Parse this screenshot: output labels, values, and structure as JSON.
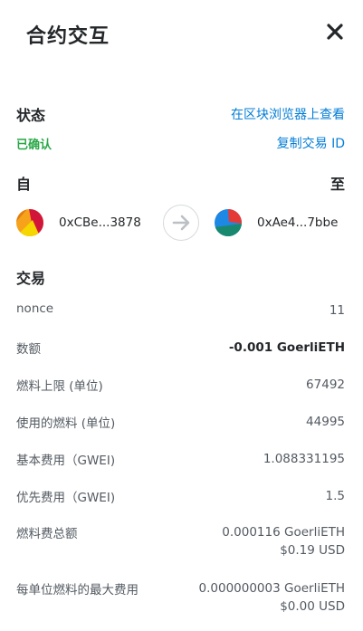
{
  "header": {
    "title": "合约交互",
    "close_icon": "close-icon"
  },
  "status": {
    "heading": "状态",
    "explorer_link": "在区块浏览器上查看",
    "state": "已确认",
    "copy_link": "复制交易 ID",
    "state_color": "#28a745",
    "link_color": "#037dd6"
  },
  "parties": {
    "from_label": "自",
    "to_label": "至",
    "from_address": "0xCBe...3878",
    "to_address": "0xAe4...7bbe",
    "arrow_icon": "arrow-right-icon"
  },
  "transaction": {
    "heading": "交易",
    "rows": [
      {
        "key": "nonce",
        "value": "11"
      },
      {
        "key": "数额",
        "value": "-0.001 GoerliETH"
      },
      {
        "key": "燃料上限 (单位)",
        "value": "67492"
      },
      {
        "key": "使用的燃料 (单位)",
        "value": "44995"
      },
      {
        "key": "基本费用（GWEI)",
        "value": "1.088331195"
      },
      {
        "key": "优先费用（GWEI)",
        "value": "1.5"
      },
      {
        "key": "燃料费总额",
        "value": "0.000116 GoerliETH",
        "sub": "$0.19 USD"
      },
      {
        "key": "每单位燃料的最大费用",
        "value": "0.000000003 GoerliETH",
        "sub": "$0.00 USD"
      }
    ]
  }
}
